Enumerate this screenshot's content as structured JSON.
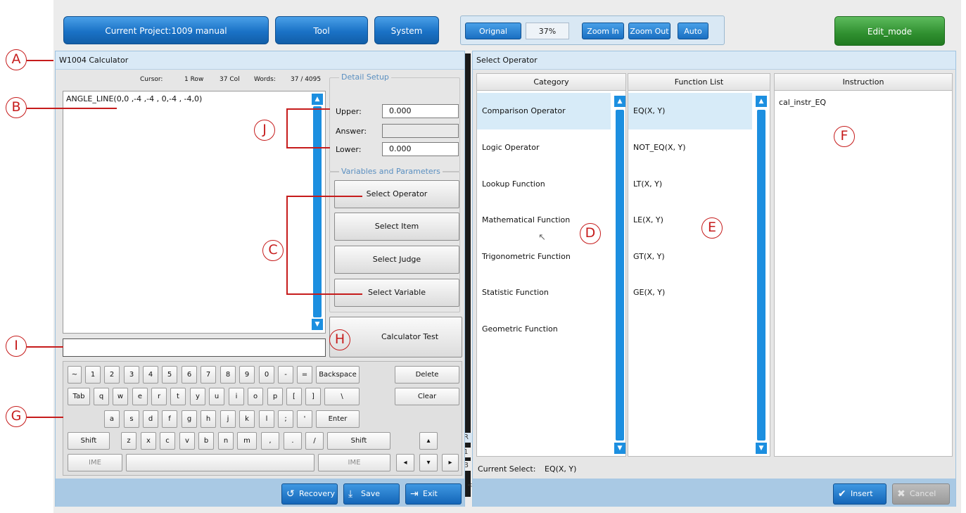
{
  "topbar": {
    "project_label": "Current Project:1009   manual",
    "tool_label": "Tool",
    "system_label": "System",
    "zoom": {
      "original": "Orignal",
      "value": "37%",
      "zoom_in": "Zoom In",
      "zoom_out": "Zoom Out",
      "auto": "Auto"
    },
    "edit_mode": "Edit_mode"
  },
  "calculator": {
    "title": "W1004 Calculator",
    "status": {
      "cursor_label": "Cursor:",
      "row": "1  Row",
      "col": "37  Col",
      "words_label": "Words:",
      "words_value": "37  /  4095"
    },
    "expression": "ANGLE_LINE(0,0 ,-4 ,-4 , 0,-4 , -4,0)",
    "detail_setup": {
      "legend": "Detail Setup",
      "upper_label": "Upper:",
      "upper_value": "0.000",
      "answer_label": "Answer:",
      "answer_value": "",
      "lower_label": "Lower:",
      "lower_value": "0.000"
    },
    "vars_params": {
      "legend": "Variables and Parameters",
      "select_operator": "Select Operator",
      "select_item": "Select Item",
      "select_judge": "Select Judge",
      "select_variable": "Select Variable"
    },
    "calculator_test": "Calculator Test",
    "input_value": "",
    "keyboard": {
      "row1": [
        "~",
        "1",
        "2",
        "3",
        "4",
        "5",
        "6",
        "7",
        "8",
        "9",
        "0",
        "-",
        "=",
        "Backspace",
        "Delete"
      ],
      "row2": [
        "Tab",
        "q",
        "w",
        "e",
        "r",
        "t",
        "y",
        "u",
        "i",
        "o",
        "p",
        "[",
        "]",
        "\\",
        "Clear"
      ],
      "row3": [
        "a",
        "s",
        "d",
        "f",
        "g",
        "h",
        "j",
        "k",
        "l",
        ";",
        "'",
        "Enter"
      ],
      "row4": [
        "Shift",
        "z",
        "x",
        "c",
        "v",
        "b",
        "n",
        "m",
        ",",
        ".",
        "/",
        "Shift",
        "▴"
      ],
      "row5": [
        "IME",
        "",
        "IME",
        "◂",
        "▾",
        "▸"
      ]
    },
    "footer": {
      "recovery": "Recovery",
      "save": "Save",
      "exit": "Exit"
    }
  },
  "operator": {
    "title": "Select Operator",
    "headers": {
      "category": "Category",
      "function_list": "Function List",
      "instruction": "Instruction"
    },
    "categories": [
      "Comparison Operator",
      "Logic Operator",
      "Lookup Function",
      "Mathematical Function",
      "Trigonometric Function",
      "Statistic Function",
      "Geometric Function"
    ],
    "functions": [
      "EQ(X, Y)",
      "NOT_EQ(X, Y)",
      "LT(X, Y)",
      "LE(X, Y)",
      "GT(X, Y)",
      "GE(X, Y)"
    ],
    "instruction_text": "cal_instr_EQ",
    "current_select_label": "Current Select:",
    "current_select_value": "EQ(X, Y)",
    "insert": "Insert",
    "cancel": "Cancel"
  },
  "background_fragments": {
    "r": "R",
    "one": "1",
    "b": "B",
    "lt": "<"
  },
  "annotations": [
    "A",
    "B",
    "C",
    "D",
    "E",
    "F",
    "G",
    "H",
    "I",
    "J"
  ],
  "colors": {
    "accent_blue": "#1c8fe0",
    "edit_green": "#2f8f2f",
    "annotation_red": "#c61c1c"
  }
}
